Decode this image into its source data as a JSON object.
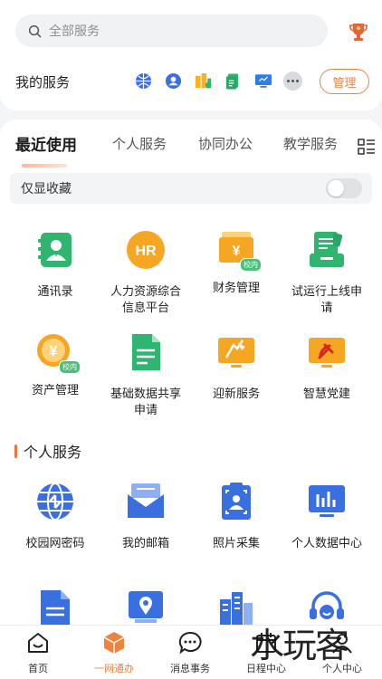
{
  "search": {
    "placeholder": "全部服务"
  },
  "my_services": {
    "title": "我的服务",
    "icons": [
      "network-icon",
      "user-icon",
      "building-icon",
      "document-icon",
      "monitor-icon"
    ],
    "manage_label": "管理"
  },
  "tabs": [
    {
      "label": "最近使用",
      "active": true
    },
    {
      "label": "个人服务",
      "active": false
    },
    {
      "label": "协同办公",
      "active": false
    },
    {
      "label": "教学服务",
      "active": false
    }
  ],
  "favorites": {
    "label": "仅显收藏",
    "enabled": false
  },
  "recent_apps": [
    {
      "label": "通讯录",
      "icon": "contacts-icon"
    },
    {
      "label": "人力资源综合信息平台",
      "icon": "hr-icon"
    },
    {
      "label": "财务管理",
      "icon": "finance-icon",
      "tag": "校内"
    },
    {
      "label": "试运行上线申请",
      "icon": "trial-icon"
    },
    {
      "label": "资产管理",
      "icon": "asset-icon",
      "tag": "校内"
    },
    {
      "label": "基础数据共享申请",
      "icon": "data-share-icon"
    },
    {
      "label": "迎新服务",
      "icon": "welcome-icon"
    },
    {
      "label": "智慧党建",
      "icon": "party-icon"
    }
  ],
  "personal_section": {
    "title": "个人服务",
    "apps": [
      {
        "label": "校园网密码",
        "icon": "campus-network-icon"
      },
      {
        "label": "我的邮箱",
        "icon": "mail-icon"
      },
      {
        "label": "照片采集",
        "icon": "photo-capture-icon"
      },
      {
        "label": "个人数据中心",
        "icon": "data-center-icon"
      },
      {
        "label": "",
        "icon": "file-icon"
      },
      {
        "label": "",
        "icon": "location-icon"
      },
      {
        "label": "",
        "icon": "buildings-icon"
      },
      {
        "label": "",
        "icon": "support-icon"
      }
    ]
  },
  "bottom_nav": [
    {
      "label": "首页",
      "icon": "home-icon",
      "active": false
    },
    {
      "label": "一网通办",
      "icon": "cube-icon",
      "active": true
    },
    {
      "label": "消息事务",
      "icon": "message-icon",
      "active": false
    },
    {
      "label": "日程中心",
      "icon": "calendar-icon",
      "active": false
    },
    {
      "label": "个人中心",
      "icon": "profile-icon",
      "active": false
    }
  ],
  "watermark": "水玩客",
  "colors": {
    "accent": "#f0823d",
    "green": "#2fb56f",
    "orange": "#f5a623",
    "blue": "#3a6fe0"
  }
}
